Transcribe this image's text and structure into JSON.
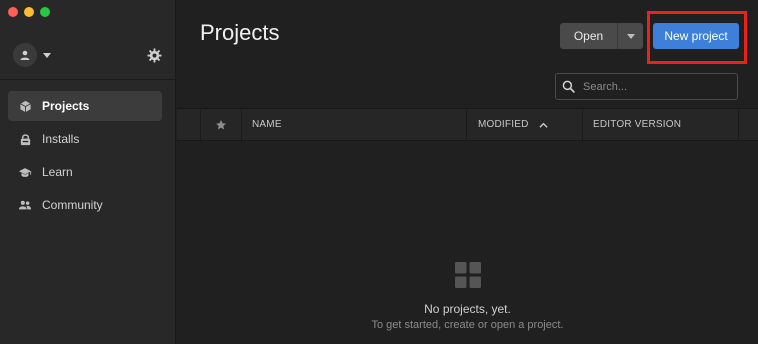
{
  "window": {
    "title": "Projects"
  },
  "sidebar": {
    "items": [
      {
        "label": "Projects",
        "icon": "cube-icon",
        "active": true
      },
      {
        "label": "Installs",
        "icon": "lock-icon",
        "active": false
      },
      {
        "label": "Learn",
        "icon": "graduation-cap-icon",
        "active": false
      },
      {
        "label": "Community",
        "icon": "people-icon",
        "active": false
      }
    ]
  },
  "header": {
    "title": "Projects",
    "open_label": "Open",
    "new_project_label": "New project"
  },
  "search": {
    "placeholder": "Search..."
  },
  "table": {
    "columns": [
      "NAME",
      "MODIFIED",
      "EDITOR VERSION"
    ]
  },
  "empty_state": {
    "title": "No projects, yet.",
    "subtitle": "To get started, create or open a project."
  },
  "colors": {
    "accent": "#3d7fd9",
    "highlight": "#e8231b",
    "sidebar_bg": "#282828",
    "main_bg": "#202020"
  }
}
